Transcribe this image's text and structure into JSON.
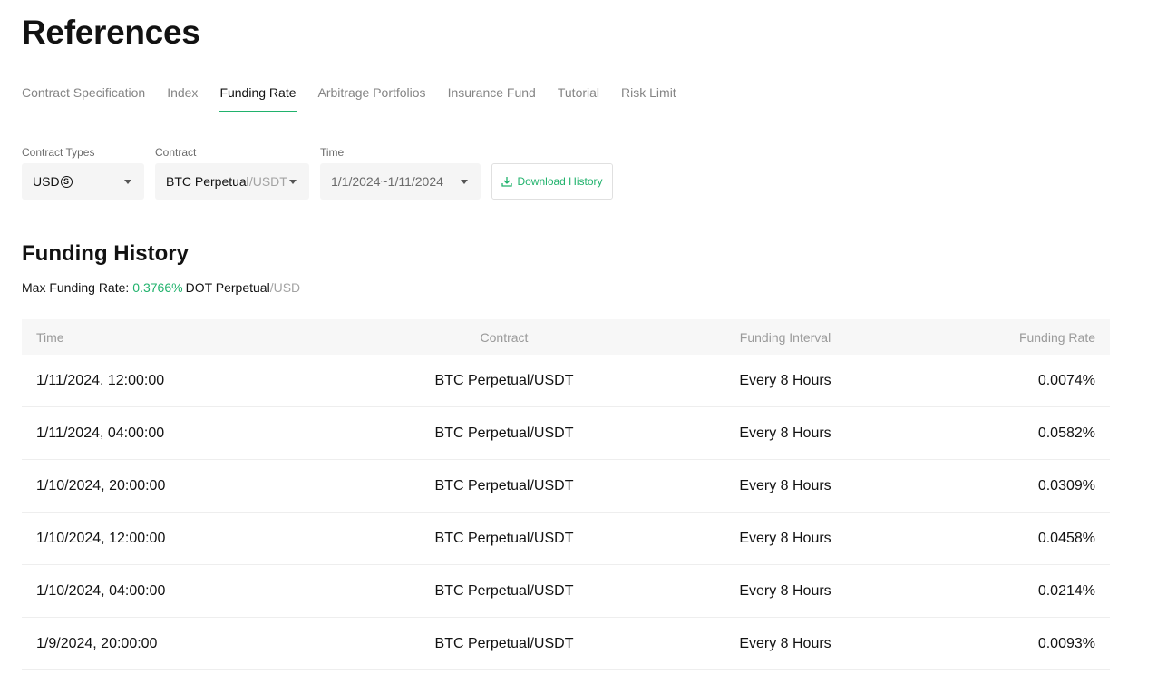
{
  "page": {
    "title": "References"
  },
  "tabs": [
    {
      "label": "Contract Specification",
      "active": false
    },
    {
      "label": "Index",
      "active": false
    },
    {
      "label": "Funding Rate",
      "active": true
    },
    {
      "label": "Arbitrage Portfolios",
      "active": false
    },
    {
      "label": "Insurance Fund",
      "active": false
    },
    {
      "label": "Tutorial",
      "active": false
    },
    {
      "label": "Risk Limit",
      "active": false
    }
  ],
  "filters": {
    "contract_types": {
      "label": "Contract Types",
      "value": "USD",
      "icon": "circled-s-icon"
    },
    "contract": {
      "label": "Contract",
      "value": "BTC Perpetual",
      "suffix": "/USDT"
    },
    "time": {
      "label": "Time",
      "value": "1/1/2024~1/11/2024"
    },
    "download": {
      "label": "Download History",
      "icon": "download-icon"
    }
  },
  "history": {
    "title": "Funding History",
    "max_label": "Max Funding Rate:",
    "max_value": "0.3766%",
    "max_contract": "DOT Perpetual",
    "max_contract_suffix": "/USD",
    "columns": [
      "Time",
      "Contract",
      "Funding Interval",
      "Funding Rate"
    ],
    "rows": [
      {
        "time": "1/11/2024, 12:00:00",
        "contract": "BTC Perpetual/USDT",
        "interval": "Every 8 Hours",
        "rate": "0.0074%"
      },
      {
        "time": "1/11/2024, 04:00:00",
        "contract": "BTC Perpetual/USDT",
        "interval": "Every 8 Hours",
        "rate": "0.0582%"
      },
      {
        "time": "1/10/2024, 20:00:00",
        "contract": "BTC Perpetual/USDT",
        "interval": "Every 8 Hours",
        "rate": "0.0309%"
      },
      {
        "time": "1/10/2024, 12:00:00",
        "contract": "BTC Perpetual/USDT",
        "interval": "Every 8 Hours",
        "rate": "0.0458%"
      },
      {
        "time": "1/10/2024, 04:00:00",
        "contract": "BTC Perpetual/USDT",
        "interval": "Every 8 Hours",
        "rate": "0.0214%"
      },
      {
        "time": "1/9/2024, 20:00:00",
        "contract": "BTC Perpetual/USDT",
        "interval": "Every 8 Hours",
        "rate": "0.0093%"
      }
    ]
  },
  "colors": {
    "accent": "#20b26c",
    "text": "#121212",
    "muted": "#858585"
  }
}
